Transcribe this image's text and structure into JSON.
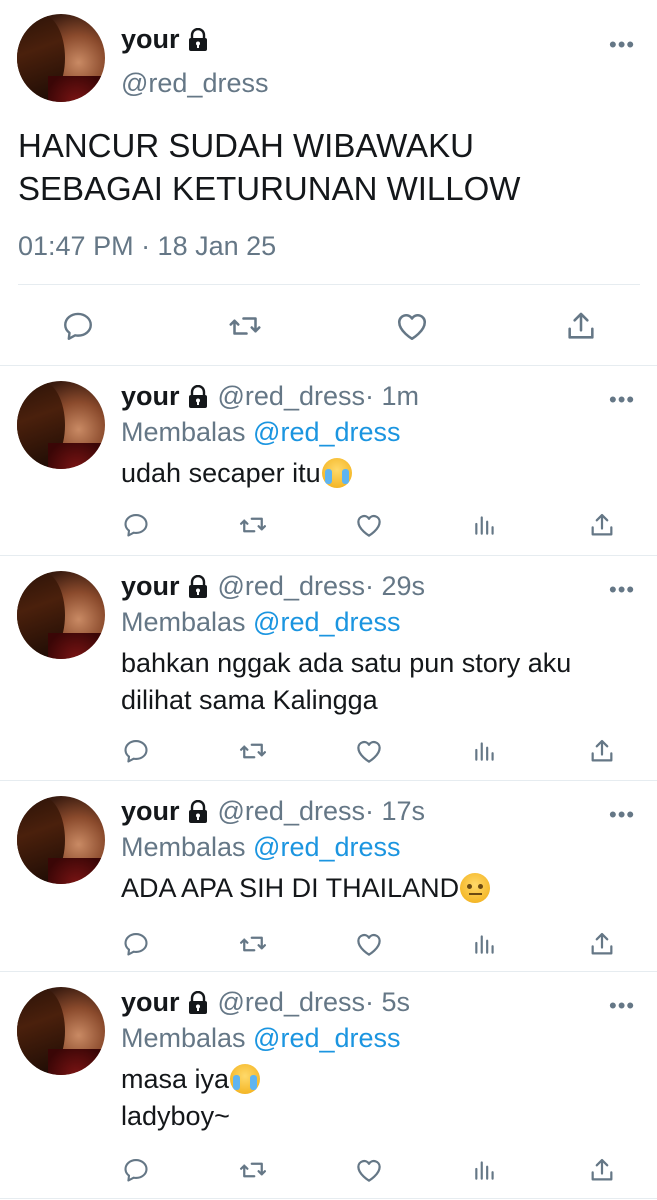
{
  "main_tweet": {
    "display_name": "your",
    "handle": "@red_dress",
    "text_line1": "HANCUR SUDAH WIBAWAKU",
    "text_line2": "SEBAGAI KETURUNAN WILLOW",
    "timestamp": "01:47 PM · 18 Jan 25",
    "more_label": "•••"
  },
  "replies": [
    {
      "display_name": "your",
      "handle": "@red_dress",
      "time": " · 1m",
      "replying_prefix": "Membalas ",
      "replying_to": "@red_dress",
      "line1": "udah secaper itu",
      "line2": "",
      "emoji": "loudly-crying-face"
    },
    {
      "display_name": "your",
      "handle": "@red_dress",
      "time": " · 29s",
      "replying_prefix": "Membalas ",
      "replying_to": "@red_dress",
      "line1": "bahkan nggak ada satu pun story aku",
      "line2": "dilihat sama Kalingga",
      "emoji": ""
    },
    {
      "display_name": "your",
      "handle": "@red_dress",
      "time": " · 17s",
      "replying_prefix": "Membalas ",
      "replying_to": "@red_dress",
      "line1": "ADA APA SIH DI THAILAND",
      "line2": "",
      "emoji": "face-with-raised-eyebrow"
    },
    {
      "display_name": "your",
      "handle": "@red_dress",
      "time": " · 5s",
      "replying_prefix": "Membalas ",
      "replying_to": "@red_dress",
      "line1": "masa iya",
      "line2": "ladyboy~",
      "emoji": "loudly-crying-face"
    }
  ],
  "more_label": "•••",
  "icons": {
    "reply": "reply-icon",
    "retweet": "retweet-icon",
    "like": "like-icon",
    "analytics": "analytics-icon",
    "share": "share-icon",
    "lock": "lock-icon"
  },
  "colors": {
    "text": "#14171a",
    "secondary": "#657786",
    "mention": "#1b95e0",
    "divider": "#e6ecf0"
  }
}
